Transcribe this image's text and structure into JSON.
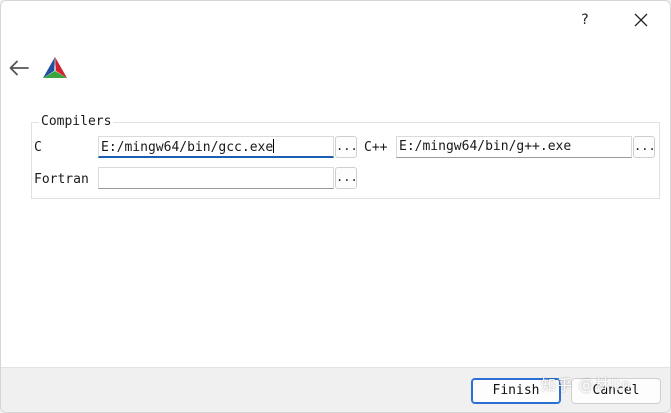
{
  "titlebar": {
    "help_label": "?"
  },
  "icons": {
    "close": "close-icon",
    "back": "arrow-left-icon",
    "logo": "cmake-logo-icon"
  },
  "colors": {
    "focus_accent": "#1a5fb4",
    "default_button_border": "#2a6fd1",
    "logo_blue": "#1f4fa3",
    "logo_red": "#d1202f",
    "logo_green": "#3aa540"
  },
  "compilers": {
    "group_title": "Compilers",
    "c": {
      "label": "C",
      "value": "E:/mingw64/bin/gcc.exe",
      "browse_label": "..."
    },
    "cpp": {
      "label": "C++",
      "value": "E:/mingw64/bin/g++.exe",
      "browse_label": "..."
    },
    "fortran": {
      "label": "Fortran",
      "value": "",
      "browse_label": "..."
    }
  },
  "footer": {
    "finish_label": "Finish",
    "cancel_label": "Cancel",
    "watermark": "知乎 @林lin"
  }
}
